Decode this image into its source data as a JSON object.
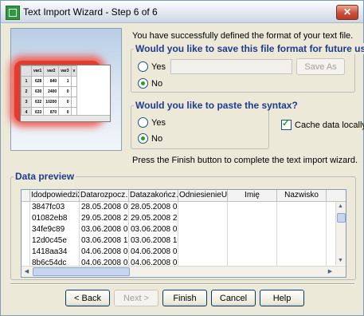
{
  "window": {
    "title": "Text Import Wizard - Step 6 of 6",
    "close_glyph": "✕"
  },
  "illustration": {
    "columns": [
      "var1",
      "var2",
      "var3",
      "v"
    ],
    "rows": [
      [
        "1",
        "628",
        "840",
        "1"
      ],
      [
        "2",
        "630",
        "2400",
        "0"
      ],
      [
        "3",
        "632",
        "10200",
        "0"
      ],
      [
        "4",
        "633",
        "870",
        "0"
      ]
    ]
  },
  "info_text": "You have successfully defined the format of your text file.",
  "save_format": {
    "label": "Would you like to save this file format for future use?",
    "yes_label": "Yes",
    "no_label": "No",
    "selected": "No",
    "path_value": "",
    "save_as_label": "Save As"
  },
  "paste_syntax": {
    "label": "Would you like to paste the syntax?",
    "yes_label": "Yes",
    "no_label": "No",
    "selected": "No"
  },
  "cache_data": {
    "label": "Cache data locally",
    "checked": true
  },
  "finish_text": "Press the Finish button to complete the text import wizard.",
  "data_preview": {
    "label": "Data preview",
    "columns": [
      "Idodpowiedzi2",
      "Datarozpocz…",
      "Datazakończ…",
      "OdniesienieU…",
      "Imię",
      "Nazwisko"
    ],
    "rows": [
      [
        "3847fc03",
        "28.05.2008 0…",
        "28.05.2008 0…",
        "",
        "",
        ""
      ],
      [
        "01082eb8",
        "29.05.2008 2…",
        "29.05.2008 2…",
        "",
        "",
        ""
      ],
      [
        "34fe9c89",
        "03.06.2008 0…",
        "03.06.2008 0…",
        "",
        "",
        ""
      ],
      [
        "12d0c45e",
        "03.06.2008 1…",
        "03.06.2008 1…",
        "",
        "",
        ""
      ],
      [
        "1418aa34",
        "04.06.2008 0…",
        "04.06.2008 0…",
        "",
        "",
        ""
      ],
      [
        "8b6c54dc",
        "04.06.2008 0…",
        "04.06.2008 0…",
        "",
        "",
        ""
      ]
    ]
  },
  "buttons": {
    "back": "< Back",
    "next": "Next >",
    "finish": "Finish",
    "cancel": "Cancel",
    "help": "Help"
  }
}
